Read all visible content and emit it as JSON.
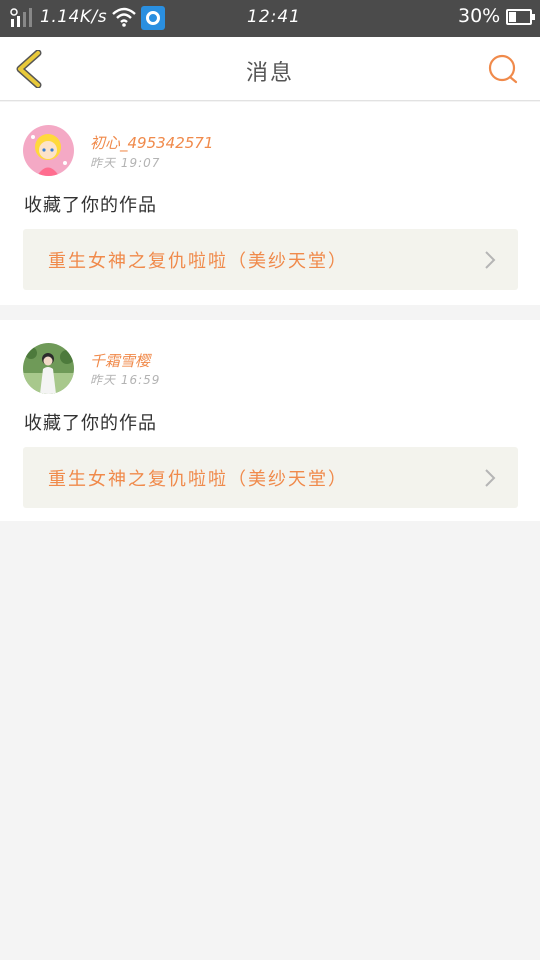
{
  "status_bar": {
    "network_speed": "1.14K/s",
    "time": "12:41",
    "battery": "30%",
    "icons": [
      "signal-icon",
      "wifi-icon",
      "app-notification-icon",
      "battery-icon"
    ]
  },
  "header": {
    "title": "消息",
    "back_icon": "chevron-left-icon",
    "search_icon": "search-icon"
  },
  "messages": [
    {
      "username": "初心_495342571",
      "time": "昨天 19:07",
      "action": "收藏了你的作品",
      "work_title": "重生女神之复仇啦啦（美纱天堂）"
    },
    {
      "username": "千霜雪樱",
      "time": "昨天 16:59",
      "action": "收藏了你的作品",
      "work_title": "重生女神之复仇啦啦（美纱天堂）"
    }
  ],
  "colors": {
    "accent": "#f08a4b",
    "back_icon": "#e8c93a",
    "status_bar": "#4b4b4b"
  }
}
